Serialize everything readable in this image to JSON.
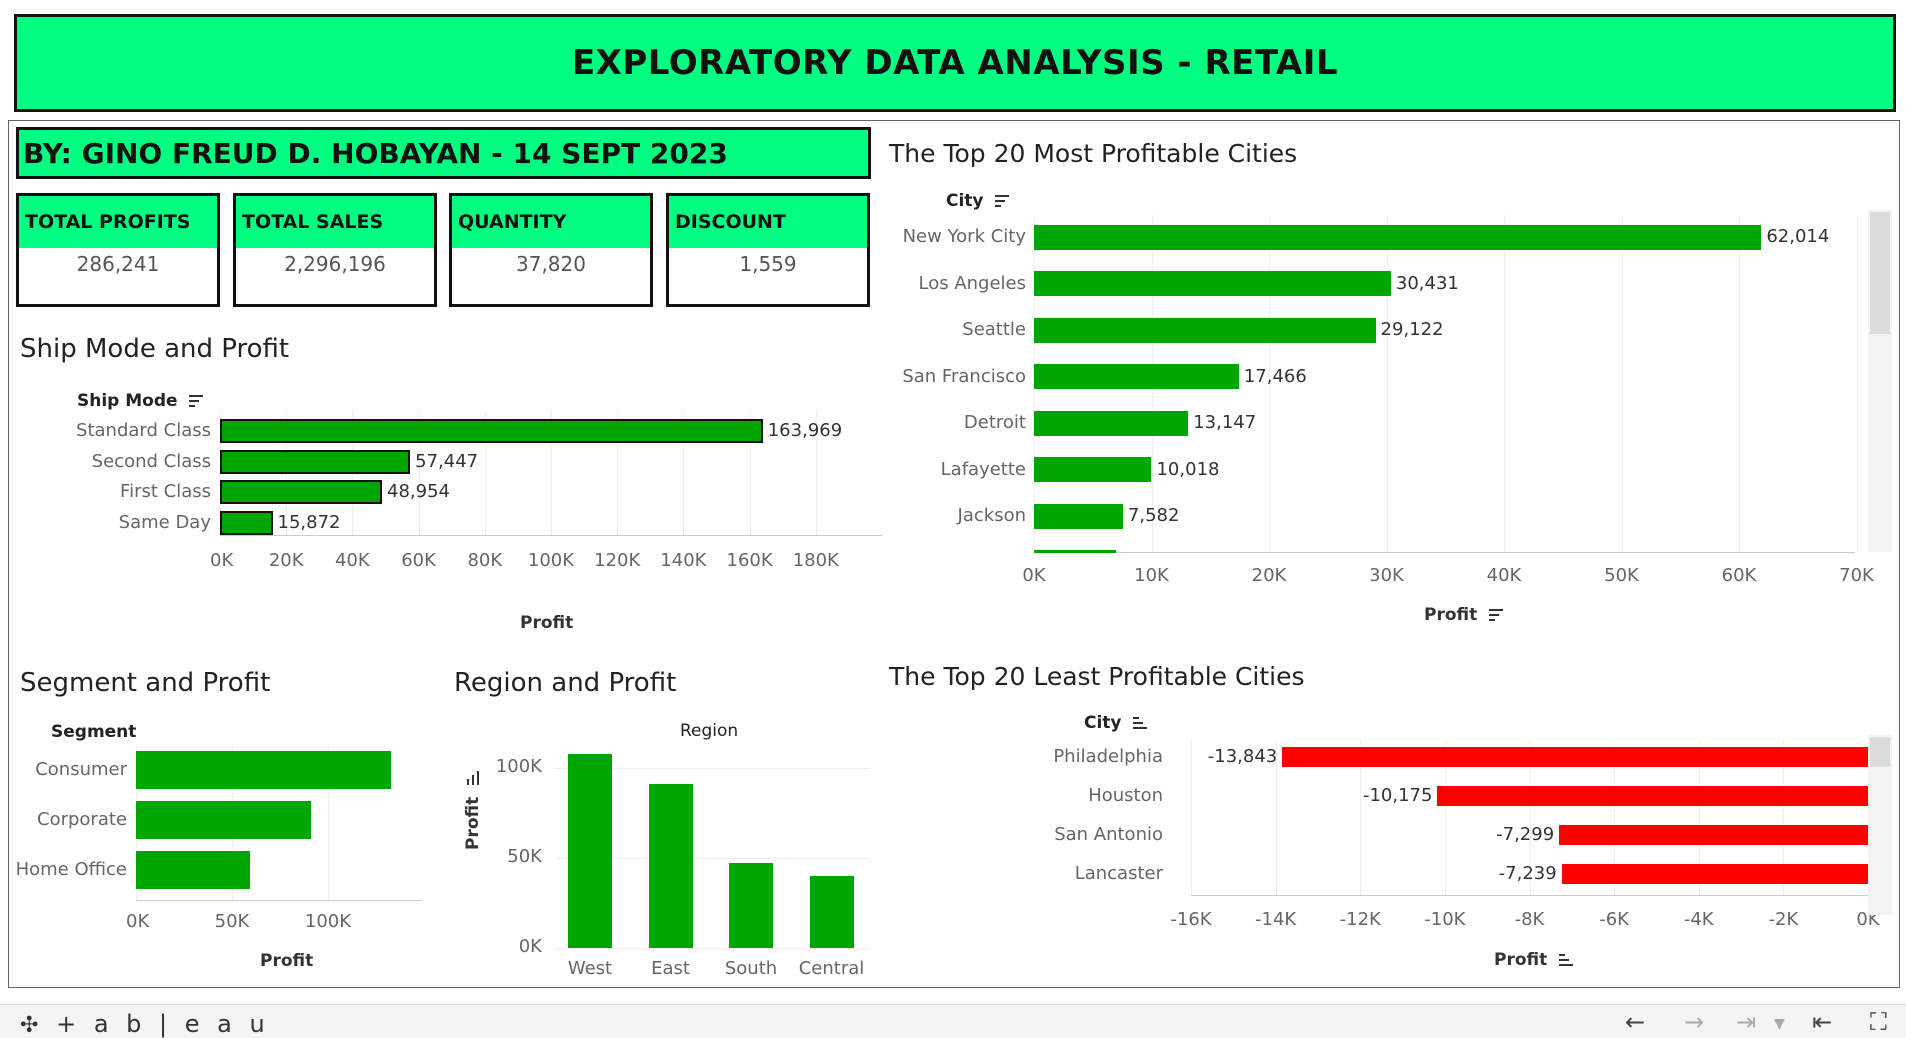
{
  "header": {
    "title": "EXPLORATORY DATA ANALYSIS - RETAIL"
  },
  "author": {
    "text": "BY: GINO FREUD D. HOBAYAN  - 14 SEPT 2023"
  },
  "kpis": [
    {
      "label": "TOTAL PROFITS",
      "value": "286,241"
    },
    {
      "label": "TOTAL SALES",
      "value": "2,296,196"
    },
    {
      "label": "QUANTITY",
      "value": "37,820"
    },
    {
      "label": "DISCOUNT",
      "value": "1,559"
    }
  ],
  "colors": {
    "accent": "#00FF80",
    "bar_green": "#00A600",
    "bar_red": "#FF0000"
  },
  "footer": {
    "logo": "+ a b | e a u"
  },
  "chart_data": [
    {
      "type": "bar",
      "orientation": "horizontal",
      "title": "Ship Mode and Profit",
      "field_label": "Ship Mode",
      "xlabel": "Profit",
      "categories": [
        "Standard Class",
        "Second Class",
        "First Class",
        "Same Day"
      ],
      "values": [
        163969,
        57447,
        48954,
        15872
      ],
      "value_labels": [
        "163,969",
        "57,447",
        "48,954",
        "15,872"
      ],
      "xlim": [
        0,
        200000
      ],
      "ticks": [
        "0K",
        "20K",
        "40K",
        "60K",
        "80K",
        "100K",
        "120K",
        "140K",
        "160K",
        "180K"
      ]
    },
    {
      "type": "bar",
      "orientation": "horizontal",
      "title": "Segment and Profit",
      "field_label": "Segment",
      "xlabel": "Profit",
      "categories": [
        "Consumer",
        "Corporate",
        "Home Office"
      ],
      "values": [
        134000,
        92000,
        60000
      ],
      "xlim": [
        0,
        150000
      ],
      "ticks": [
        "0K",
        "50K",
        "100K"
      ]
    },
    {
      "type": "bar",
      "orientation": "vertical",
      "title": "Region and Profit",
      "field_label": "Region",
      "ylabel": "Profit",
      "categories": [
        "West",
        "East",
        "South",
        "Central"
      ],
      "values": [
        108000,
        91000,
        47000,
        40000
      ],
      "ylim": [
        0,
        115000
      ],
      "ticks": [
        "100K",
        "50K",
        "0K"
      ]
    },
    {
      "type": "bar",
      "orientation": "horizontal",
      "title": "The Top 20 Most Profitable Cities",
      "field_label": "City",
      "xlabel": "Profit",
      "categories": [
        "New York City",
        "Los Angeles",
        "Seattle",
        "San Francisco",
        "Detroit",
        "Lafayette",
        "Jackson"
      ],
      "values": [
        62014,
        30431,
        29122,
        17466,
        13147,
        10018,
        7582
      ],
      "value_labels": [
        "62,014",
        "30,431",
        "29,122",
        "17,466",
        "13,147",
        "10,018",
        "7,582"
      ],
      "xlim": [
        0,
        70000
      ],
      "ticks": [
        "0K",
        "10K",
        "20K",
        "30K",
        "40K",
        "50K",
        "60K",
        "70K"
      ]
    },
    {
      "type": "bar",
      "orientation": "horizontal",
      "title": "The Top 20 Least Profitable Cities",
      "field_label": "City",
      "xlabel": "Profit",
      "categories": [
        "Philadelphia",
        "Houston",
        "San Antonio",
        "Lancaster"
      ],
      "values": [
        -13843,
        -10175,
        -7299,
        -7239
      ],
      "value_labels": [
        "-13,843",
        "-10,175",
        "-7,299",
        "-7,239"
      ],
      "xlim": [
        -16000,
        0
      ],
      "ticks": [
        "-16K",
        "-14K",
        "-12K",
        "-10K",
        "-8K",
        "-6K",
        "-4K",
        "-2K",
        "0K"
      ]
    }
  ]
}
